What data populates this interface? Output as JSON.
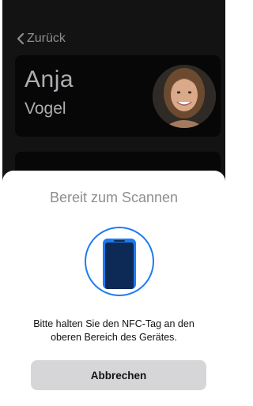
{
  "nav": {
    "back_label": "Zurück",
    "back_icon": "chevron-left-icon"
  },
  "contact": {
    "first_name": "Anja",
    "last_name": "Vogel",
    "avatar_icon": "avatar-photo"
  },
  "scan_sheet": {
    "title": "Bereit zum Scannen",
    "instruction_line1": "Bitte halten Sie den NFC-Tag an den",
    "instruction_line2": "oberen Bereich des Gerätes.",
    "cancel_label": "Abbrechen",
    "illustration_icon": "phone-nfc-icon"
  },
  "colors": {
    "accent": "#1d7bf0",
    "background": "#131313",
    "card": "#070707",
    "button": "#d6d6d9",
    "muted_text": "#8e8e93"
  }
}
